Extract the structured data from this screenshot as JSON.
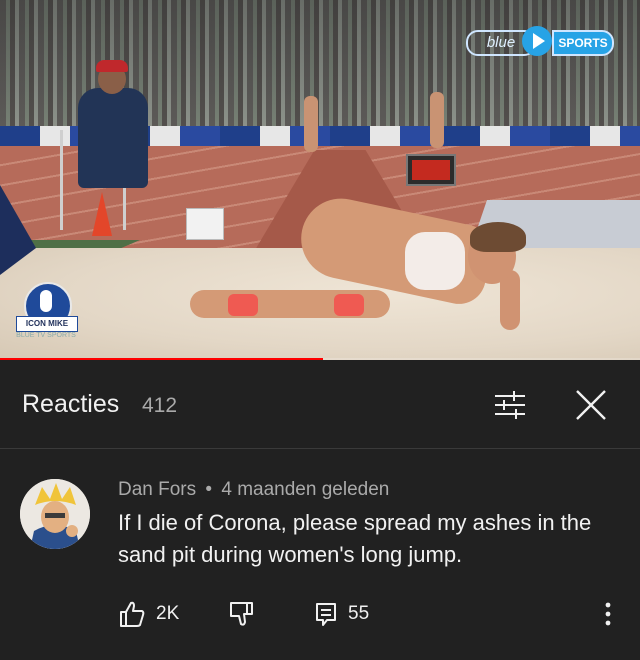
{
  "video": {
    "channel_logo_left": "blue",
    "channel_logo_right": "SPORTS",
    "watermark_label": "ICON MIKE",
    "watermark_sub": "BLUE TV SPORTS",
    "scoreboard_text": "",
    "progress_fraction": 0.505,
    "progress_color": "#ff0000"
  },
  "panel": {
    "title": "Reacties",
    "count": "412",
    "filter_icon": "sliders-icon",
    "close_icon": "close-icon"
  },
  "comment": {
    "author": "Dan Fors",
    "separator": "•",
    "age": "4 maanden geleden",
    "text": "If I die of Corona, please spread my ashes in the sand pit during women's long jump.",
    "likes": "2K",
    "replies": "55",
    "like_icon": "thumbs-up-icon",
    "dislike_icon": "thumbs-down-icon",
    "reply_icon": "reply-icon",
    "more_icon": "more-vertical-icon"
  },
  "colors": {
    "background": "#212121",
    "primary_text": "#f1f1f1",
    "secondary_text": "#aaaaaa",
    "accent_red": "#ff0000"
  }
}
